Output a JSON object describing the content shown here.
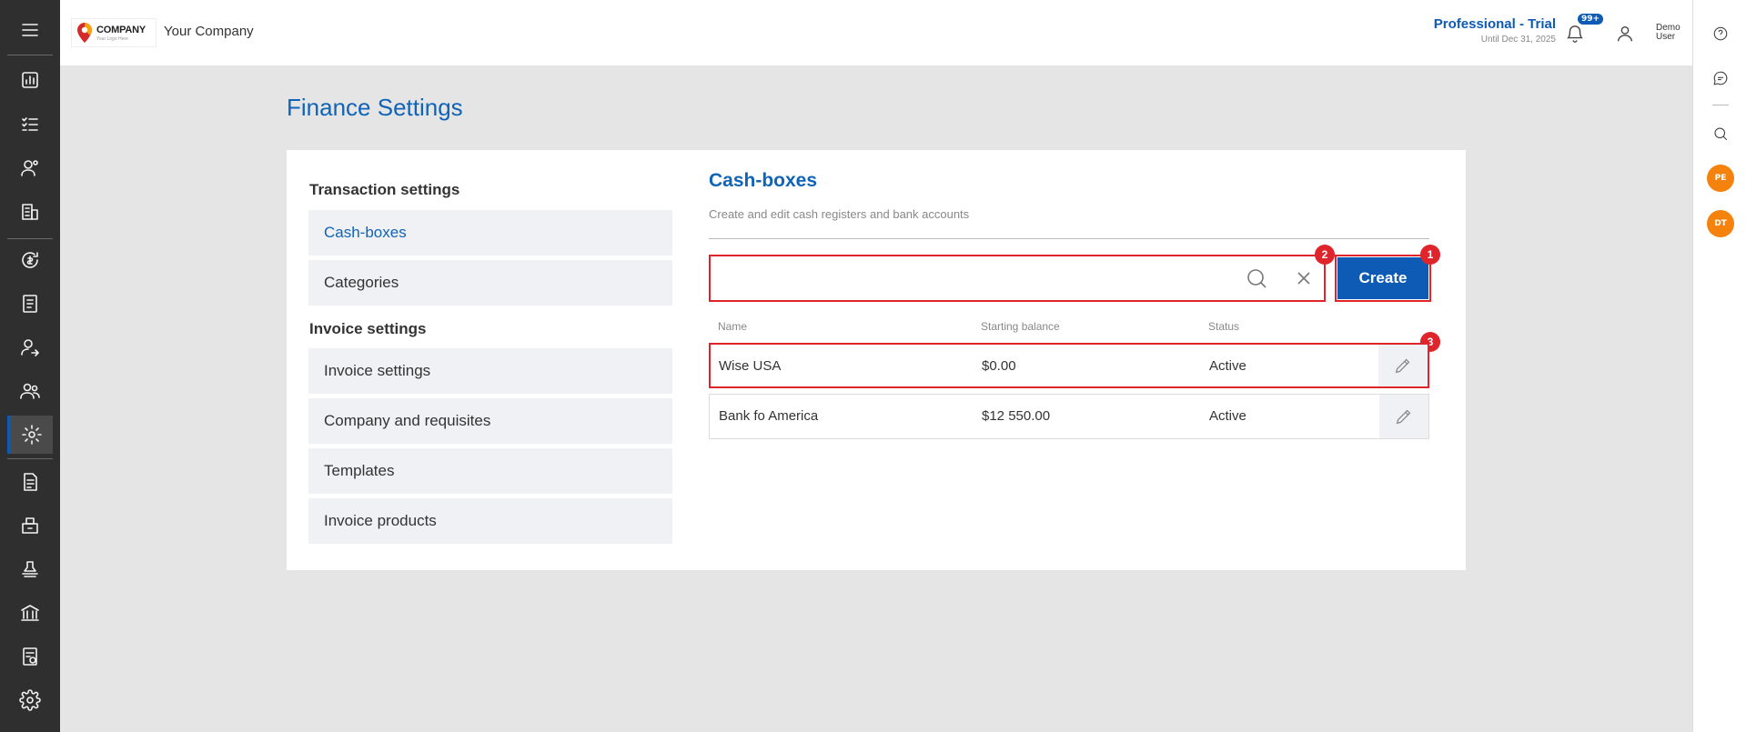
{
  "header": {
    "logo_name": "COMPANY",
    "logo_tagline": "Your Logo Here",
    "company_name": "Your Company",
    "plan_name": "Professional - Trial",
    "plan_until": "Until Dec 31, 2025",
    "notifications_badge": "99+",
    "user_name_line1": "Demo",
    "user_name_line2": "User"
  },
  "sidebar": {
    "icons": [
      "menu-icon",
      "dashboard-icon",
      "tasks-icon",
      "contacts-icon",
      "companies-icon",
      "finance-icon",
      "ledger-icon",
      "client-icon",
      "team-icon",
      "finance-settings-icon",
      "invoice-icon",
      "inventory-icon",
      "stamp-icon",
      "bank-icon",
      "reports-icon",
      "settings-icon"
    ]
  },
  "right_rail": {
    "avatars": [
      "PE",
      "DT"
    ]
  },
  "page": {
    "title": "Finance Settings"
  },
  "settings_menu": {
    "transaction_heading": "Transaction settings",
    "transaction_items": [
      "Cash-boxes",
      "Categories"
    ],
    "invoice_heading": "Invoice settings",
    "invoice_items": [
      "Invoice settings",
      "Company and requisites",
      "Templates",
      "Invoice products"
    ]
  },
  "cashboxes": {
    "title": "Cash-boxes",
    "subtitle": "Create and edit cash registers and bank accounts",
    "search_value": "",
    "create_label": "Create",
    "columns": [
      "Name",
      "Starting balance",
      "Status"
    ],
    "rows": [
      {
        "name": "Wise USA",
        "balance": "$0.00",
        "status": "Active"
      },
      {
        "name": "Bank fo America",
        "balance": "$12 550.00",
        "status": "Active"
      }
    ]
  },
  "callouts": [
    "1",
    "2",
    "3"
  ],
  "colors": {
    "accent": "#0d5bb5",
    "sidebar_bg": "#2f2f2f",
    "highlight": "#e0242c",
    "avatar": "#f5820d"
  }
}
